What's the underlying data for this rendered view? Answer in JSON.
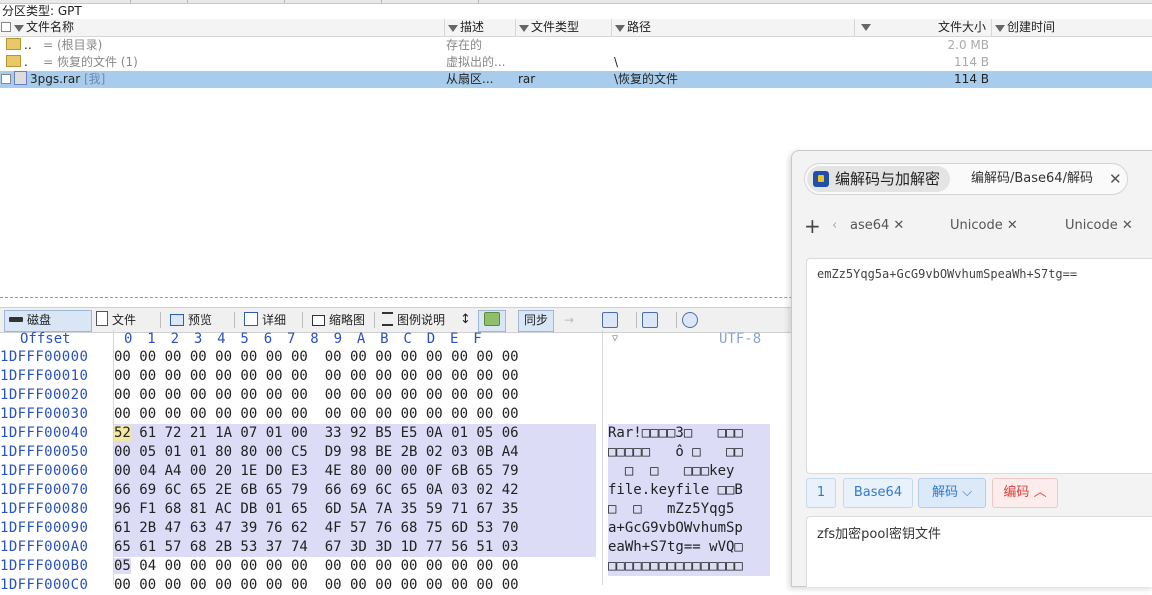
{
  "partition": {
    "label": "分区类型: GPT"
  },
  "file_table": {
    "columns": {
      "name": "文件名称",
      "desc": "描述",
      "type": "文件类型",
      "path": "路径",
      "size": "文件大小",
      "created": "创建时间"
    },
    "rows": [
      {
        "name": "..",
        "tag": "=  (根目录)",
        "desc": "存在的",
        "type": "",
        "path": "",
        "size": "2.0 MB"
      },
      {
        "name": ".",
        "tag": "=  恢复的文件 (1)",
        "desc": "虚拟出的...",
        "type": "",
        "path": "\\",
        "size": "114 B"
      },
      {
        "name": "3pgs.rar",
        "tag": "[我]",
        "desc": "从扇区...",
        "type": "rar",
        "path": "\\恢复的文件",
        "size": "114 B"
      }
    ]
  },
  "toolbar": {
    "disk": "磁盘",
    "file": "文件",
    "preview": "预览",
    "detail": "详细",
    "thumbnail": "缩略图",
    "legend": "图例说明",
    "sync": "同步"
  },
  "hex": {
    "offset_label": "Offset",
    "columns": "0  1  2  3  4  5  6  7  8  9  A  B  C  D  E  F",
    "encoding": "UTF-8",
    "rows": [
      {
        "offset": "1DFFF00000",
        "bytes": "00 00 00 00 00 00 00 00  00 00 00 00 00 00 00 00",
        "text": ""
      },
      {
        "offset": "1DFFF00010",
        "bytes": "00 00 00 00 00 00 00 00  00 00 00 00 00 00 00 00",
        "text": ""
      },
      {
        "offset": "1DFFF00020",
        "bytes": "00 00 00 00 00 00 00 00  00 00 00 00 00 00 00 00",
        "text": ""
      },
      {
        "offset": "1DFFF00030",
        "bytes": "00 00 00 00 00 00 00 00  00 00 00 00 00 00 00 00",
        "text": ""
      },
      {
        "offset": "1DFFF00040",
        "first": "52",
        "bytes": " 61 72 21 1A 07 01 00  33 92 B5 E5 0A 01 05 06",
        "text": "Rar!□□□□3□   □□□"
      },
      {
        "offset": "1DFFF00050",
        "bytes": "00 05 01 01 80 80 00 C5  D9 98 BE 2B 02 03 0B A4",
        "text": "□□□□□   ô □   □□"
      },
      {
        "offset": "1DFFF00060",
        "bytes": "00 04 A4 00 20 1E D0 E3  4E 80 00 00 0F 6B 65 79",
        "text": "  □  □   □□□key"
      },
      {
        "offset": "1DFFF00070",
        "bytes": "66 69 6C 65 2E 6B 65 79  66 69 6C 65 0A 03 02 42",
        "text": "file.keyfile □□B"
      },
      {
        "offset": "1DFFF00080",
        "bytes": "96 F1 68 81 AC DB 01 65  6D 5A 7A 35 59 71 67 35",
        "text": "□  □   mZz5Yqg5"
      },
      {
        "offset": "1DFFF00090",
        "bytes": "61 2B 47 63 47 39 76 62  4F 57 76 68 75 6D 53 70",
        "text": "a+GcG9vbOWvhumSp"
      },
      {
        "offset": "1DFFF000A0",
        "bytes": "65 61 57 68 2B 53 37 74  67 3D 3D 1D 77 56 51 03",
        "text": "eaWh+S7tg== wVQ□"
      },
      {
        "offset": "1DFFF000B0",
        "first": "05",
        "bytes": " 04 00 00 00 00 00 00  00 00 00 00 00 00 00 00",
        "text": "□□□□□□□□□□□□□□□□"
      },
      {
        "offset": "1DFFF000C0",
        "bytes": "00 00 00 00 00 00 00 00  00 00 00 00 00 00 00 00",
        "text": ""
      }
    ]
  },
  "panel": {
    "title": "编解码与加解密",
    "second_tab": "编解码/Base64/解码",
    "sub_tabs": [
      "ase64",
      "Unicode",
      "Unicode"
    ],
    "input": "emZz5Yqg5a+GcG9vbOWvhumSpeaWh+S7tg==",
    "buttons": {
      "one": "1",
      "base64": "Base64",
      "decode": "解码",
      "encode": "编码"
    },
    "output": "zfs加密pool密钥文件"
  }
}
